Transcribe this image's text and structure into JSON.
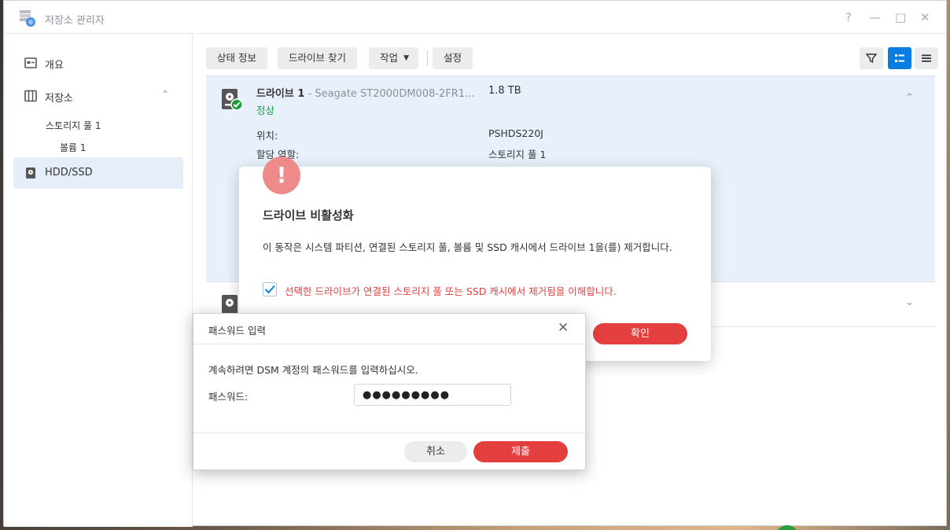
{
  "window": {
    "title": "저장소 관리자",
    "controls": {
      "help": "?",
      "minimize": "—",
      "maximize": "□",
      "close": "✕"
    }
  },
  "sidebar": {
    "items": [
      {
        "label": "개요",
        "icon": "overview-icon"
      },
      {
        "label": "저장소",
        "icon": "storage-icon"
      },
      {
        "label": "HDD/SSD",
        "icon": "hdd-icon"
      }
    ],
    "sub_items": [
      "스토리지 풀 1",
      "볼륨 1"
    ]
  },
  "toolbar": {
    "status_info": "상태 정보",
    "find_drive": "드라이브 찾기",
    "action": "작업",
    "settings": "설정"
  },
  "drive1": {
    "name": "드라이브 1",
    "model": "- Seagate ST2000DM008-2FR1...",
    "size": "1.8 TB",
    "status": "정상",
    "details": [
      {
        "label": "위치:",
        "value": "PSHDS220J"
      },
      {
        "label": "할당 역할:",
        "value": "스토리지 풀 1"
      }
    ],
    "status_color": "#1a9c3a"
  },
  "deactivate_dialog": {
    "title": "드라이브 비활성화",
    "message": "이 동작은 시스템 파티션, 연결된 스토리지 풀, 볼륨 및 SSD 캐시에서 드라이브 1을(를) 제거합니다.",
    "checkbox_label": "선택한 드라이브가 연결된 스토리지 풀 또는 SSD 캐시에서 제거됨을 이해합니다.",
    "confirm": "확인",
    "checkbox_checked": true
  },
  "password_dialog": {
    "title": "패스워드 입력",
    "message": "계속하려면 DSM 계정의 패스워드를 입력하십시오.",
    "password_label": "패스워드:",
    "password_value": "●●●●●●●●●",
    "cancel": "취소",
    "submit": "제출"
  },
  "colors": {
    "accent_blue": "#0a7de3",
    "danger_red": "#e43f3f",
    "ok_green": "#1a9c3a"
  }
}
